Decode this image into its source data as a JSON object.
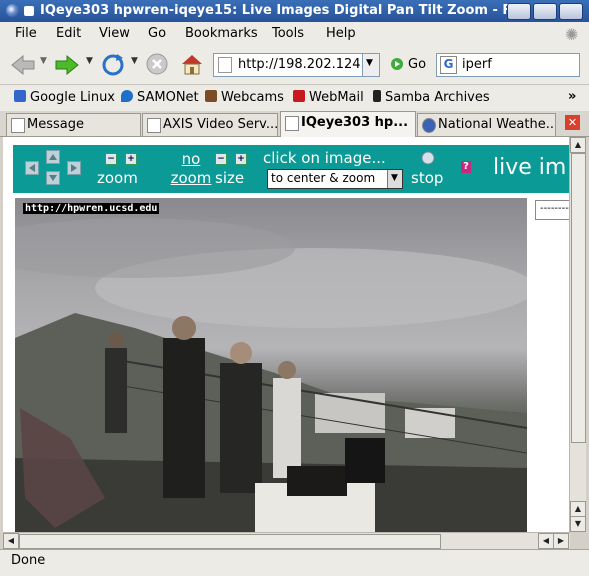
{
  "window": {
    "title": "IQeye303 hpwren-iqeye15: Live Images Digital Pan Tilt Zoom - Fi"
  },
  "menu": [
    "File",
    "Edit",
    "View",
    "Go",
    "Bookmarks",
    "Tools",
    "Help"
  ],
  "nav": {
    "url": "http://198.202.124.",
    "go_label": "Go",
    "search_value": "iperf"
  },
  "bookmarks": [
    {
      "label": "Google Linux",
      "icon": "google-icon",
      "color": "#3366cc"
    },
    {
      "label": "SAMONet",
      "icon": "drop-icon",
      "color": "#1e6fc7"
    },
    {
      "label": "Webcams",
      "icon": "webcams-icon",
      "color": "#7a4b24"
    },
    {
      "label": "WebMail",
      "icon": "yahoo-icon",
      "color": "#c7191f"
    },
    {
      "label": "Samba Archives",
      "icon": "samba-icon",
      "color": "#222222"
    }
  ],
  "tabs": [
    {
      "label": "Message",
      "active": false
    },
    {
      "label": "AXIS Video Serv...",
      "active": false
    },
    {
      "label": "IQeye303 hp...",
      "active": true
    },
    {
      "label": "National Weathe...",
      "active": false
    }
  ],
  "controls": {
    "zoom_label": "zoom",
    "no_zoom_link": "no zoom",
    "size_label": "size",
    "click_label": "click on image...",
    "select_value": "to center & zoom",
    "stop_label": "stop",
    "help_label": "?",
    "live_label": "live im",
    "bar_color": "#0b9a95"
  },
  "image": {
    "watermark": "http://hpwren.ucsd.edu"
  },
  "right_frame_text": "--------",
  "status": "Done"
}
